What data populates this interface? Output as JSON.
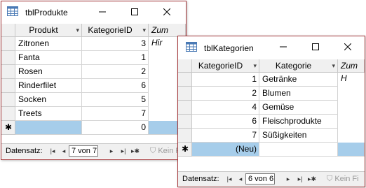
{
  "win1": {
    "title": "tblProdukte",
    "columns": [
      "Produkt",
      "KategorieID",
      "Zum Hir"
    ],
    "rows": [
      {
        "produkt": "Zitronen",
        "kategorie": "3"
      },
      {
        "produkt": "Fanta",
        "kategorie": "1"
      },
      {
        "produkt": "Rosen",
        "kategorie": "2"
      },
      {
        "produkt": "Rinderfilet",
        "kategorie": "6"
      },
      {
        "produkt": "Socken",
        "kategorie": "5"
      },
      {
        "produkt": "Treets",
        "kategorie": "7"
      }
    ],
    "new_row": {
      "marker": "✱",
      "kategorie": "0"
    },
    "nav": {
      "label": "Datensatz:",
      "record": "7 von 7",
      "filter": "Kein F"
    }
  },
  "win2": {
    "title": "tblKategorien",
    "columns": [
      "KategorieID",
      "Kategorie",
      "Zum H"
    ],
    "rows": [
      {
        "id": "1",
        "kategorie": "Getränke"
      },
      {
        "id": "2",
        "kategorie": "Blumen"
      },
      {
        "id": "4",
        "kategorie": "Gemüse"
      },
      {
        "id": "6",
        "kategorie": "Fleischprodukte"
      },
      {
        "id": "7",
        "kategorie": "Süßigkeiten"
      }
    ],
    "new_row": {
      "marker": "✱",
      "id": "(Neu)"
    },
    "nav": {
      "label": "Datensatz:",
      "record": "6 von 6",
      "filter": "Kein Fi"
    }
  },
  "icons": {
    "table": "table-icon",
    "minimize": "minimize-icon",
    "maximize": "maximize-icon",
    "close": "close-icon"
  },
  "colors": {
    "accent_border": "#a4373a",
    "new_row_highlight": "#a6cdea"
  }
}
